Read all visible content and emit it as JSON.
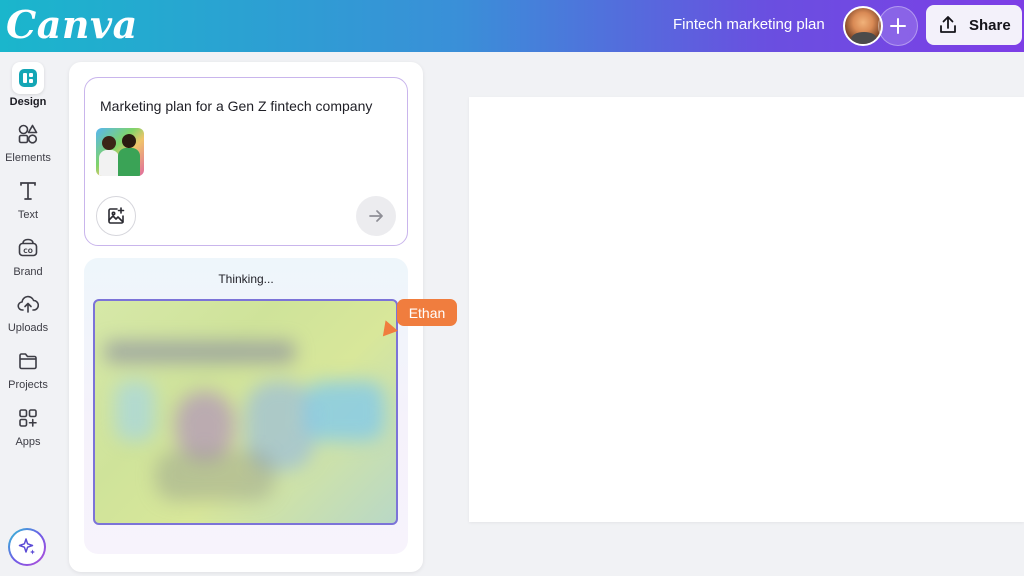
{
  "header": {
    "logo": "Canva",
    "doc_title": "Fintech marketing plan",
    "share_label": "Share"
  },
  "rail": {
    "items": [
      {
        "label": "Design",
        "icon": "design-icon",
        "active": true
      },
      {
        "label": "Elements",
        "icon": "elements-icon"
      },
      {
        "label": "Text",
        "icon": "text-icon"
      },
      {
        "label": "Brand",
        "icon": "brand-icon"
      },
      {
        "label": "Uploads",
        "icon": "uploads-icon"
      },
      {
        "label": "Projects",
        "icon": "folder-icon"
      },
      {
        "label": "Apps",
        "icon": "apps-icon"
      }
    ],
    "magic_icon": "sparkle-icon"
  },
  "panel": {
    "prompt": "Marketing plan for a Gen Z fintech company",
    "thinking_label": "Thinking..."
  },
  "cursor": {
    "name": "Ethan",
    "color": "#f07d3e"
  },
  "colors": {
    "accent": "#7d3ee6",
    "header_start": "#1ab6cc",
    "preview_border": "#7c73d8"
  }
}
